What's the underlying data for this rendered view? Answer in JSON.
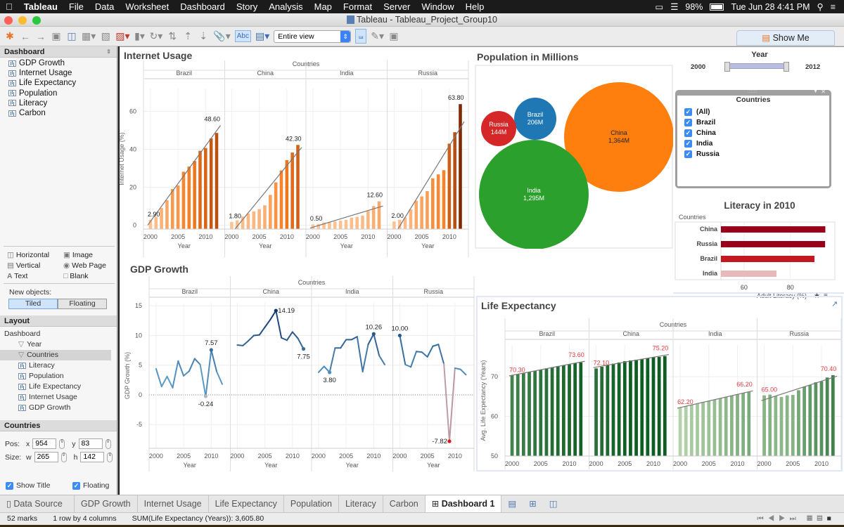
{
  "menubar": {
    "app": "Tableau",
    "items": [
      "File",
      "Data",
      "Worksheet",
      "Dashboard",
      "Story",
      "Analysis",
      "Map",
      "Format",
      "Server",
      "Window",
      "Help"
    ],
    "battery": "98%",
    "datetime": "Tue Jun 28  4:41 PM"
  },
  "window": {
    "title": "Tableau - Tableau_Project_Group10"
  },
  "toolbar": {
    "fit_value": "Entire view",
    "show_labels_btn": "Abc",
    "show_me": "Show Me"
  },
  "sidebar": {
    "dashboard_header": "Dashboard",
    "sheets": [
      "GDP Growth",
      "Internet Usage",
      "Life Expectancy",
      "Population",
      "Literacy",
      "Carbon"
    ],
    "objects": [
      {
        "label": "Horizontal",
        "icon": "horizontal-icon"
      },
      {
        "label": "Image",
        "icon": "image-icon"
      },
      {
        "label": "Vertical",
        "icon": "vertical-icon"
      },
      {
        "label": "Web Page",
        "icon": "globe-icon"
      },
      {
        "label": "Text",
        "icon": "text-icon"
      },
      {
        "label": "Blank",
        "icon": "blank-icon"
      }
    ],
    "new_objects_label": "New objects:",
    "tiled": "Tiled",
    "floating_btn": "Floating",
    "layout_header": "Layout",
    "layout_root": "Dashboard",
    "layout_items": [
      "Year",
      "Countries",
      "Literacy",
      "Population",
      "Life Expectancy",
      "Internet Usage",
      "GDP Growth"
    ],
    "selected_header": "Countries",
    "pos_label": "Pos:",
    "size_label": "Size:",
    "x": "954",
    "y": "83",
    "w": "265",
    "h": "142",
    "show_title": "Show Title",
    "floating_chk": "Floating"
  },
  "tabs": [
    "Data Source",
    "GDP Growth",
    "Internet Usage",
    "Life Expectancy",
    "Population",
    "Literacy",
    "Carbon",
    "Dashboard 1"
  ],
  "status": {
    "marks": "52 marks",
    "layout": "1 row by 4 columns",
    "sum": "SUM(Life Expectancy (Years)): 3,605.80"
  },
  "filters": {
    "year_title": "Year",
    "year_min": "2000",
    "year_max": "2012",
    "countries_title": "Countries",
    "countries": [
      "(All)",
      "Brazil",
      "China",
      "India",
      "Russia"
    ]
  },
  "colors": {
    "orange_dark": "#7f2704",
    "blue": "#1f77b4",
    "green": "#2ca02c",
    "red": "#d62728",
    "orange": "#ff7f0e"
  },
  "chart_data": [
    {
      "id": "internet",
      "type": "bar",
      "title": "Internet Usage",
      "column_header": "Countries",
      "xlabel": "Year",
      "ylabel": "Internet Usage (%)",
      "ylim": [
        -2,
        72
      ],
      "yticks": [
        0,
        20,
        40,
        60
      ],
      "xticks": [
        2000,
        2005,
        2010
      ],
      "x": [
        2000,
        2001,
        2002,
        2003,
        2004,
        2005,
        2006,
        2007,
        2008,
        2009,
        2010,
        2011,
        2012
      ],
      "trend_lines": true,
      "series": [
        {
          "name": "Brazil",
          "values": [
            2.9,
            4.5,
            9.1,
            13.2,
            19.1,
            21.0,
            28.2,
            30.9,
            33.8,
            39.2,
            40.7,
            45.7,
            48.6
          ],
          "labels": {
            "first": "2.90",
            "last": "48.60"
          }
        },
        {
          "name": "China",
          "values": [
            1.8,
            2.6,
            4.6,
            6.2,
            7.3,
            8.5,
            10.5,
            16.0,
            22.6,
            28.9,
            34.3,
            38.3,
            42.3
          ],
          "labels": {
            "first": "1.80",
            "last": "42.30"
          }
        },
        {
          "name": "India",
          "values": [
            0.5,
            0.7,
            1.5,
            1.7,
            2.0,
            2.4,
            2.8,
            4.0,
            4.4,
            5.1,
            7.5,
            10.1,
            12.6
          ],
          "labels": {
            "first": "0.50",
            "last": "12.60"
          }
        },
        {
          "name": "Russia",
          "values": [
            2.0,
            2.9,
            4.1,
            8.3,
            12.9,
            15.2,
            18.0,
            24.7,
            26.8,
            29.0,
            43.0,
            49.0,
            63.8
          ],
          "labels": {
            "first": "2.00",
            "last": "63.80"
          }
        }
      ]
    },
    {
      "id": "population",
      "type": "bubble",
      "title": "Population in Millions",
      "points": [
        {
          "name": "China",
          "value": 1364,
          "label": "1,364M"
        },
        {
          "name": "India",
          "value": 1295,
          "label": "1,295M"
        },
        {
          "name": "Brazil",
          "value": 206,
          "label": "206M"
        },
        {
          "name": "Russia",
          "value": 144,
          "label": "144M"
        }
      ]
    },
    {
      "id": "literacy",
      "type": "bar",
      "orientation": "horizontal",
      "title": "Literacy in 2010",
      "ylabel": "Countries",
      "xlabel": "Adult Literacy (%)",
      "xlim": [
        50,
        98
      ],
      "xticks": [
        60,
        80
      ],
      "categories": [
        "China",
        "Russia",
        "Brazil",
        "India"
      ],
      "values": [
        95.1,
        95.0,
        90.4,
        74.0
      ]
    },
    {
      "id": "gdp",
      "type": "line",
      "title": "GDP Growth",
      "column_header": "Countries",
      "xlabel": "Year",
      "ylabel": "GDP Growth (%)",
      "ylim": [
        -9,
        15.5
      ],
      "yticks": [
        -5,
        0,
        5,
        10,
        15
      ],
      "xticks": [
        2000,
        2005,
        2010
      ],
      "x": [
        2000,
        2001,
        2002,
        2003,
        2004,
        2005,
        2006,
        2007,
        2008,
        2009,
        2010,
        2011,
        2012
      ],
      "series": [
        {
          "name": "Brazil",
          "values": [
            4.4,
            1.4,
            3.1,
            1.2,
            5.7,
            3.2,
            4.0,
            6.1,
            5.1,
            -0.24,
            7.57,
            3.9,
            1.8
          ],
          "labels": [
            {
              "i": 10,
              "text": "7.57",
              "pos": "above"
            },
            {
              "i": 9,
              "text": "-0.24",
              "pos": "below"
            }
          ]
        },
        {
          "name": "China",
          "values": [
            8.4,
            8.3,
            9.1,
            10.0,
            10.1,
            11.4,
            12.7,
            14.19,
            9.6,
            9.2,
            10.6,
            9.5,
            7.75
          ],
          "labels": [
            {
              "i": 7,
              "text": "14.19",
              "pos": "right"
            },
            {
              "i": 12,
              "text": "7.75",
              "pos": "below"
            }
          ]
        },
        {
          "name": "India",
          "values": [
            3.8,
            4.8,
            3.8,
            7.9,
            7.9,
            9.3,
            9.3,
            9.8,
            3.9,
            8.5,
            10.26,
            6.6,
            5.1
          ],
          "labels": [
            {
              "i": 2,
              "text": "3.80",
              "pos": "below"
            },
            {
              "i": 10,
              "text": "10.26",
              "pos": "above"
            }
          ]
        },
        {
          "name": "Russia",
          "values": [
            10.0,
            5.1,
            4.7,
            7.3,
            7.2,
            6.4,
            8.2,
            8.5,
            5.2,
            -7.82,
            4.5,
            4.3,
            3.4
          ],
          "labels": [
            {
              "i": 0,
              "text": "10.00",
              "pos": "above"
            },
            {
              "i": 9,
              "text": "-7.82",
              "pos": "left"
            }
          ]
        }
      ]
    },
    {
      "id": "life",
      "type": "bar",
      "title": "Life Expectancy",
      "column_header": "Countries",
      "xlabel": "Year",
      "ylabel": "Avg. Life Expectancy (Years)",
      "ylim": [
        50,
        78
      ],
      "yticks": [
        50,
        60,
        70
      ],
      "xticks": [
        2000,
        2005,
        2010
      ],
      "x": [
        2000,
        2001,
        2002,
        2003,
        2004,
        2005,
        2006,
        2007,
        2008,
        2009,
        2010,
        2011,
        2012
      ],
      "trend_lines": true,
      "series": [
        {
          "name": "Brazil",
          "values": [
            70.3,
            70.6,
            70.9,
            71.2,
            71.5,
            71.8,
            72.1,
            72.4,
            72.7,
            72.9,
            73.1,
            73.4,
            73.6
          ],
          "labels": {
            "first": "70.30",
            "last": "73.60"
          }
        },
        {
          "name": "China",
          "values": [
            72.1,
            72.5,
            72.9,
            73.3,
            73.6,
            73.9,
            74.1,
            74.3,
            74.5,
            74.7,
            74.9,
            75.0,
            75.2
          ],
          "labels": {
            "first": "72.10",
            "last": "75.20"
          }
        },
        {
          "name": "India",
          "values": [
            62.2,
            62.6,
            62.9,
            63.2,
            63.6,
            63.9,
            64.2,
            64.5,
            64.9,
            65.2,
            65.6,
            65.9,
            66.2
          ],
          "labels": {
            "first": "62.20",
            "last": "66.20"
          }
        },
        {
          "name": "Russia",
          "values": [
            65.3,
            65.5,
            65.1,
            64.9,
            65.3,
            65.4,
            66.6,
            67.5,
            67.9,
            68.6,
            68.8,
            69.8,
            70.4
          ],
          "labels": {
            "first": "65.00",
            "last": "70.40"
          }
        }
      ]
    }
  ]
}
